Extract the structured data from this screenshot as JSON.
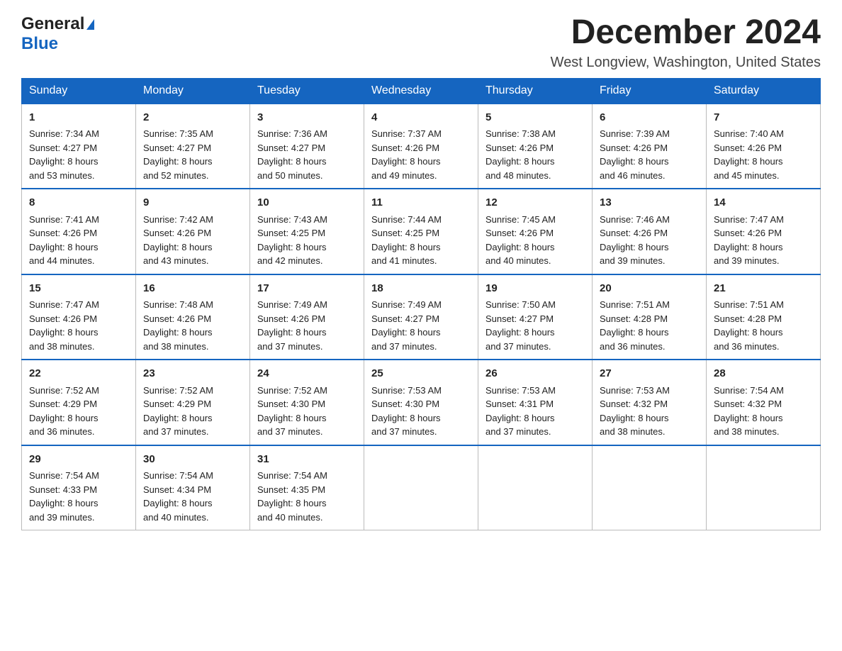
{
  "logo": {
    "general": "General",
    "triangle": "▶",
    "blue": "Blue"
  },
  "title": "December 2024",
  "location": "West Longview, Washington, United States",
  "days_of_week": [
    "Sunday",
    "Monday",
    "Tuesday",
    "Wednesday",
    "Thursday",
    "Friday",
    "Saturday"
  ],
  "weeks": [
    [
      {
        "day": "1",
        "sunrise": "7:34 AM",
        "sunset": "4:27 PM",
        "daylight": "8 hours and 53 minutes."
      },
      {
        "day": "2",
        "sunrise": "7:35 AM",
        "sunset": "4:27 PM",
        "daylight": "8 hours and 52 minutes."
      },
      {
        "day": "3",
        "sunrise": "7:36 AM",
        "sunset": "4:27 PM",
        "daylight": "8 hours and 50 minutes."
      },
      {
        "day": "4",
        "sunrise": "7:37 AM",
        "sunset": "4:26 PM",
        "daylight": "8 hours and 49 minutes."
      },
      {
        "day": "5",
        "sunrise": "7:38 AM",
        "sunset": "4:26 PM",
        "daylight": "8 hours and 48 minutes."
      },
      {
        "day": "6",
        "sunrise": "7:39 AM",
        "sunset": "4:26 PM",
        "daylight": "8 hours and 46 minutes."
      },
      {
        "day": "7",
        "sunrise": "7:40 AM",
        "sunset": "4:26 PM",
        "daylight": "8 hours and 45 minutes."
      }
    ],
    [
      {
        "day": "8",
        "sunrise": "7:41 AM",
        "sunset": "4:26 PM",
        "daylight": "8 hours and 44 minutes."
      },
      {
        "day": "9",
        "sunrise": "7:42 AM",
        "sunset": "4:26 PM",
        "daylight": "8 hours and 43 minutes."
      },
      {
        "day": "10",
        "sunrise": "7:43 AM",
        "sunset": "4:25 PM",
        "daylight": "8 hours and 42 minutes."
      },
      {
        "day": "11",
        "sunrise": "7:44 AM",
        "sunset": "4:25 PM",
        "daylight": "8 hours and 41 minutes."
      },
      {
        "day": "12",
        "sunrise": "7:45 AM",
        "sunset": "4:26 PM",
        "daylight": "8 hours and 40 minutes."
      },
      {
        "day": "13",
        "sunrise": "7:46 AM",
        "sunset": "4:26 PM",
        "daylight": "8 hours and 39 minutes."
      },
      {
        "day": "14",
        "sunrise": "7:47 AM",
        "sunset": "4:26 PM",
        "daylight": "8 hours and 39 minutes."
      }
    ],
    [
      {
        "day": "15",
        "sunrise": "7:47 AM",
        "sunset": "4:26 PM",
        "daylight": "8 hours and 38 minutes."
      },
      {
        "day": "16",
        "sunrise": "7:48 AM",
        "sunset": "4:26 PM",
        "daylight": "8 hours and 38 minutes."
      },
      {
        "day": "17",
        "sunrise": "7:49 AM",
        "sunset": "4:26 PM",
        "daylight": "8 hours and 37 minutes."
      },
      {
        "day": "18",
        "sunrise": "7:49 AM",
        "sunset": "4:27 PM",
        "daylight": "8 hours and 37 minutes."
      },
      {
        "day": "19",
        "sunrise": "7:50 AM",
        "sunset": "4:27 PM",
        "daylight": "8 hours and 37 minutes."
      },
      {
        "day": "20",
        "sunrise": "7:51 AM",
        "sunset": "4:28 PM",
        "daylight": "8 hours and 36 minutes."
      },
      {
        "day": "21",
        "sunrise": "7:51 AM",
        "sunset": "4:28 PM",
        "daylight": "8 hours and 36 minutes."
      }
    ],
    [
      {
        "day": "22",
        "sunrise": "7:52 AM",
        "sunset": "4:29 PM",
        "daylight": "8 hours and 36 minutes."
      },
      {
        "day": "23",
        "sunrise": "7:52 AM",
        "sunset": "4:29 PM",
        "daylight": "8 hours and 37 minutes."
      },
      {
        "day": "24",
        "sunrise": "7:52 AM",
        "sunset": "4:30 PM",
        "daylight": "8 hours and 37 minutes."
      },
      {
        "day": "25",
        "sunrise": "7:53 AM",
        "sunset": "4:30 PM",
        "daylight": "8 hours and 37 minutes."
      },
      {
        "day": "26",
        "sunrise": "7:53 AM",
        "sunset": "4:31 PM",
        "daylight": "8 hours and 37 minutes."
      },
      {
        "day": "27",
        "sunrise": "7:53 AM",
        "sunset": "4:32 PM",
        "daylight": "8 hours and 38 minutes."
      },
      {
        "day": "28",
        "sunrise": "7:54 AM",
        "sunset": "4:32 PM",
        "daylight": "8 hours and 38 minutes."
      }
    ],
    [
      {
        "day": "29",
        "sunrise": "7:54 AM",
        "sunset": "4:33 PM",
        "daylight": "8 hours and 39 minutes."
      },
      {
        "day": "30",
        "sunrise": "7:54 AM",
        "sunset": "4:34 PM",
        "daylight": "8 hours and 40 minutes."
      },
      {
        "day": "31",
        "sunrise": "7:54 AM",
        "sunset": "4:35 PM",
        "daylight": "8 hours and 40 minutes."
      },
      null,
      null,
      null,
      null
    ]
  ],
  "labels": {
    "sunrise": "Sunrise:",
    "sunset": "Sunset:",
    "daylight": "Daylight:"
  }
}
